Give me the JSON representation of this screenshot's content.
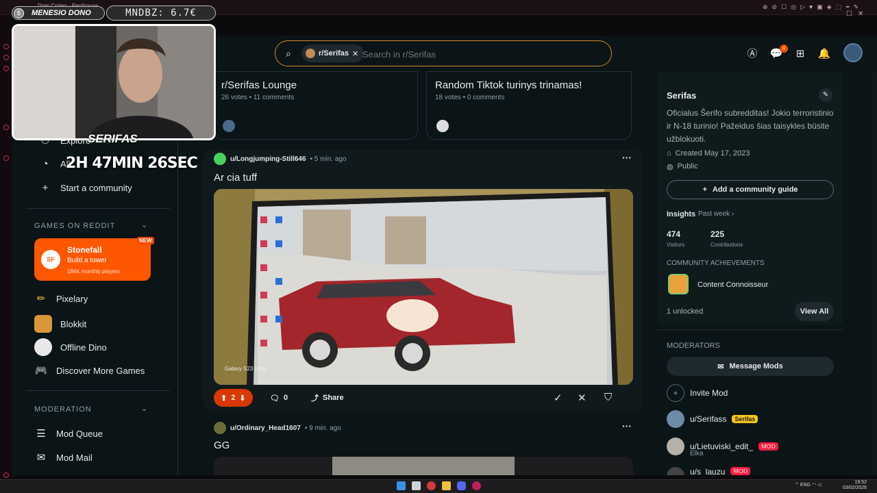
{
  "browser": {
    "tab_title": "Dom Corleo - Penthouse"
  },
  "overlay": {
    "streamer_name": "MENESIO DONO",
    "coin_symbol": "$",
    "rate": "MNDBZ: 6.7€",
    "cam_name": "SERIFAS",
    "timer": "2H 47MIN 26SEC"
  },
  "header": {
    "search_chip": "r/Serifas",
    "search_placeholder": "Search in r/Serifas",
    "chat_badge": "4"
  },
  "sidebar": {
    "explore": "Explore",
    "all": "All",
    "start_community": "Start a community",
    "games_title": "GAMES ON REDDIT",
    "featured_game": {
      "name": "Stonefall",
      "tagline": "Build a tower",
      "players": "184K monthly players",
      "badge": "NEW",
      "logo_text": "SF"
    },
    "games": [
      "Pixelary",
      "Blokkit",
      "Offline Dino",
      "Discover More Games"
    ],
    "moderation_title": "MODERATION",
    "mod_items": [
      "Mod Queue",
      "Mod Mail"
    ]
  },
  "pinned": [
    {
      "title": "r/Serifas Lounge",
      "stats": "26 votes • 11 comments"
    },
    {
      "title": "Random Tiktok turinys trinamas!",
      "stats": "18 votes • 0 comments"
    }
  ],
  "posts": [
    {
      "author": "u/Longjumping-Still646",
      "time": "• 5 min. ago",
      "title": "Ar cia tuff",
      "votes": "2",
      "comments": "0",
      "share": "Share",
      "watermark": "Galaxy S23 Ultra"
    },
    {
      "author": "u/Ordinary_Head1607",
      "time": "• 9 min. ago",
      "title": "GG"
    }
  ],
  "about": {
    "name": "Serifas",
    "description": "Oficialus Šerifo subredditas! Jokio terroristinio ir N-18 turinio! Pažeidus šias taisykles būsite užblokuoti.",
    "created": "Created May 17, 2023",
    "visibility": "Public",
    "guide_button": "Add a community guide",
    "insights_label": "Insights",
    "insights_period": "Past week ›",
    "visitors": "474",
    "visitors_label": "Visitors",
    "contributions": "225",
    "contributions_label": "Contributions",
    "achievements_title": "COMMUNITY ACHIEVEMENTS",
    "achievement": "Content Connoisseur",
    "unlocked": "1 unlocked",
    "view_all": "View All",
    "moderators_title": "MODERATORS",
    "message_mods": "Message Mods",
    "invite_mod": "Invite Mod",
    "mods": [
      {
        "name": "u/Serifass",
        "flair": "Serifas",
        "sub": ""
      },
      {
        "name": "u/Lietuviski_edit_",
        "flair": "MOD",
        "sub": "Elka"
      },
      {
        "name": "u/s_lauzu",
        "flair": "MOD",
        "sub": ""
      }
    ]
  },
  "taskbar": {
    "lang": "ENG",
    "time": "19:52",
    "date": "03/02/2026"
  },
  "colors": {
    "accent": "#ff4500",
    "background": "#0b1416",
    "search_border": "#d38b2a",
    "flair_yellow": "#f5c518"
  }
}
